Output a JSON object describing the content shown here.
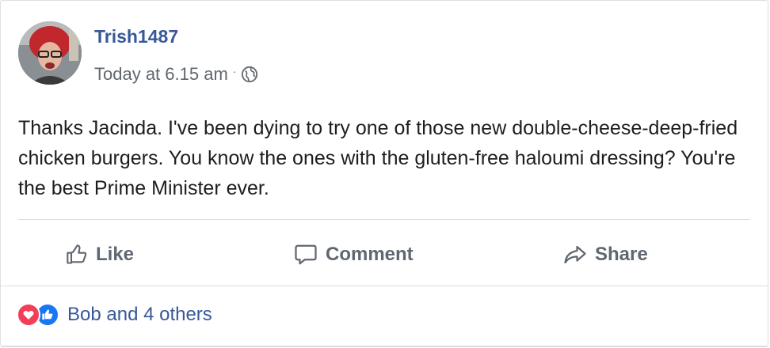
{
  "post": {
    "author": "Trish1487",
    "timestamp": "Today at 6.15 am",
    "privacy_icon": "globe-icon",
    "body": "Thanks Jacinda. I've been dying to try one of those new double-cheese-deep-fried chicken burgers. You know the ones with the gluten-free haloumi dressing? You're the best Prime Minister ever."
  },
  "actions": {
    "like_label": "Like",
    "comment_label": "Comment",
    "share_label": "Share"
  },
  "reactions": {
    "summary": "Bob and 4 others",
    "types": [
      "love",
      "like"
    ]
  },
  "colors": {
    "author_name": "#385898",
    "love": "#f33e58",
    "like": "#1877f2",
    "action_text": "#606770"
  }
}
